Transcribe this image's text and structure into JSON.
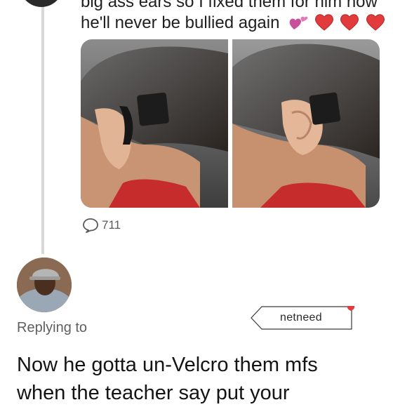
{
  "tweet": {
    "text_line1": "big ass ears so I fixed them for him now",
    "text_line2": "he'll never be bullied again",
    "emoji": [
      "two-hearts",
      "red-heart",
      "red-heart",
      "red-heart"
    ],
    "media": [
      "boy-ear-velcro-photo-1",
      "boy-ear-velcro-photo-2"
    ],
    "reply_count": "711"
  },
  "reply": {
    "replying_to": "Replying to",
    "text_line1": "Now he gotta un-Velcro them mfs",
    "text_line2": "when the teacher say put your"
  },
  "watermark": {
    "label": "netneed",
    "accent_color": "#e23b3b"
  },
  "colors": {
    "heart": "#e23b3b",
    "thread_line": "#d8d8d8",
    "secondary_text": "#5f5f5f"
  }
}
